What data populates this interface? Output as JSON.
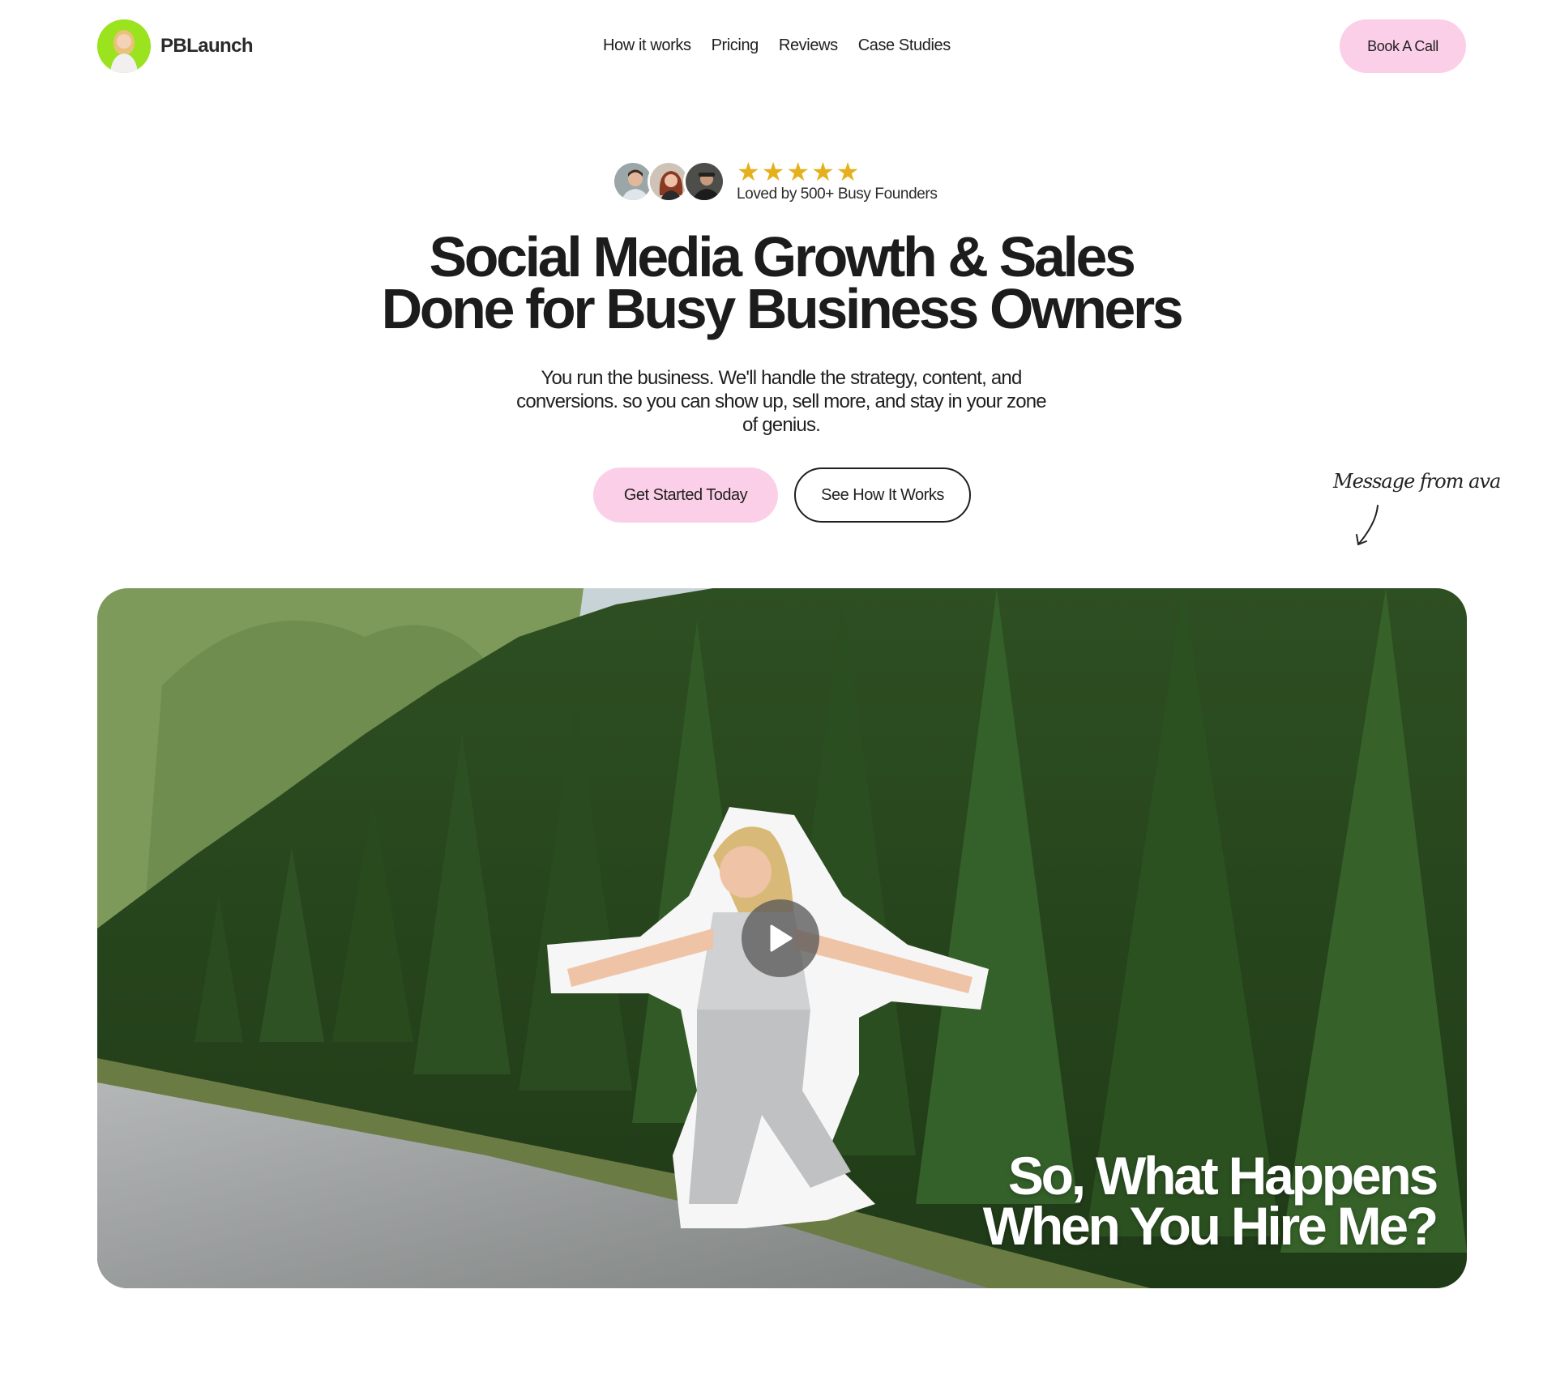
{
  "brand": {
    "name": "PBLaunch"
  },
  "nav": {
    "items": [
      {
        "label": "How it works"
      },
      {
        "label": "Pricing"
      },
      {
        "label": "Reviews"
      },
      {
        "label": "Case Studies"
      }
    ]
  },
  "header": {
    "cta_label": "Book A Call"
  },
  "social_proof": {
    "rating": 5,
    "rating_max": 5,
    "text": "Loved by 500+ Busy Founders"
  },
  "hero": {
    "headline_line1": "Social Media Growth & Sales",
    "headline_line2": "Done for Busy Business Owners",
    "subtext": "You run the business. We'll handle the strategy, content, and conversions. so you can show up, sell more, and stay in your zone of genius.",
    "primary_cta": "Get Started Today",
    "secondary_cta": "See How It Works"
  },
  "note": {
    "text": "Message from ava"
  },
  "video": {
    "title_line1": "So, What Happens",
    "title_line2": "When You Hire Me?"
  },
  "colors": {
    "accent_pink": "#fccfe9",
    "star_gold": "#e5b01c",
    "logo_green": "#9be21f",
    "text_dark": "#1c1c1c"
  },
  "icons": [
    "logo-avatar",
    "star-icon",
    "play-icon",
    "arrow-down-icon"
  ]
}
